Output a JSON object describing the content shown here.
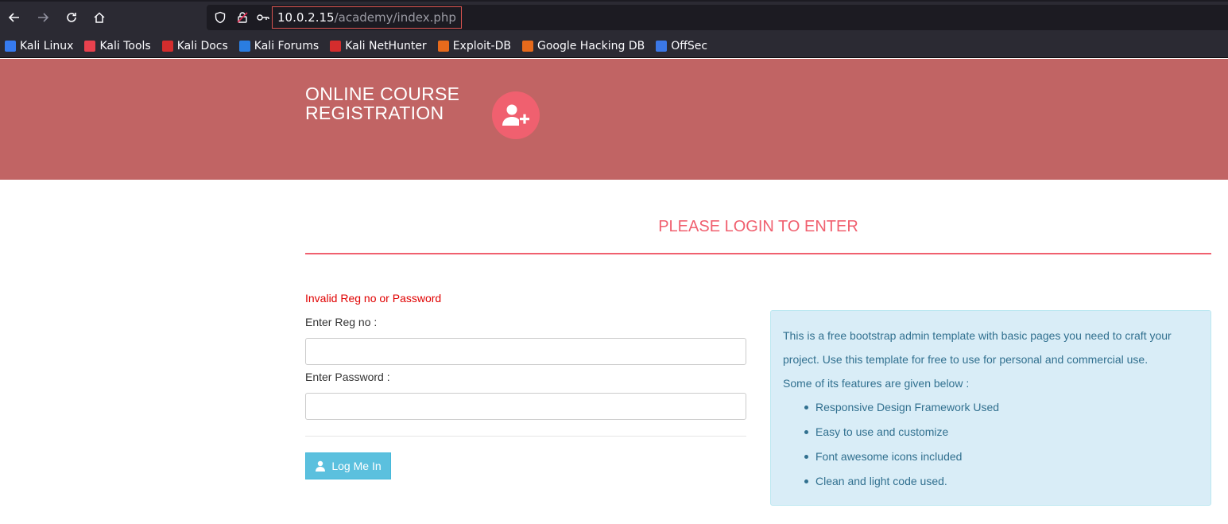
{
  "browser": {
    "url_host": "10.0.2.15",
    "url_path": "/academy/index.php",
    "bookmarks": [
      {
        "label": "Kali Linux",
        "color": "#367bf0"
      },
      {
        "label": "Kali Tools",
        "color": "#e8414e"
      },
      {
        "label": "Kali Docs",
        "color": "#d42d2d"
      },
      {
        "label": "Kali Forums",
        "color": "#2a7de1"
      },
      {
        "label": "Kali NetHunter",
        "color": "#d42d2d"
      },
      {
        "label": "Exploit-DB",
        "color": "#e66a1c"
      },
      {
        "label": "Google Hacking DB",
        "color": "#e66a1c"
      },
      {
        "label": "OffSec",
        "color": "#3b78e7"
      }
    ]
  },
  "header": {
    "title_line1": "ONLINE COURSE",
    "title_line2": "REGISTRATION",
    "logo_icon": "user-plus-icon",
    "bg_color": "#c16464",
    "accent_color": "#f0606f"
  },
  "login": {
    "heading": "PLEASE LOGIN TO ENTER",
    "error": "Invalid Reg no or Password",
    "reg_label": "Enter Reg no :",
    "reg_value": "",
    "password_label": "Enter Password :",
    "password_value": "",
    "button_label": "Log Me In",
    "button_icon": "user-icon"
  },
  "info": {
    "text": "This is a free bootstrap admin template with basic pages you need to craft your project. Use this template for free to use for personal and commercial use.",
    "subhead": "Some of its features are given below :",
    "features": [
      "Responsive Design Framework Used",
      "Easy to use and customize",
      "Font awesome icons included",
      "Clean and light code used."
    ]
  }
}
